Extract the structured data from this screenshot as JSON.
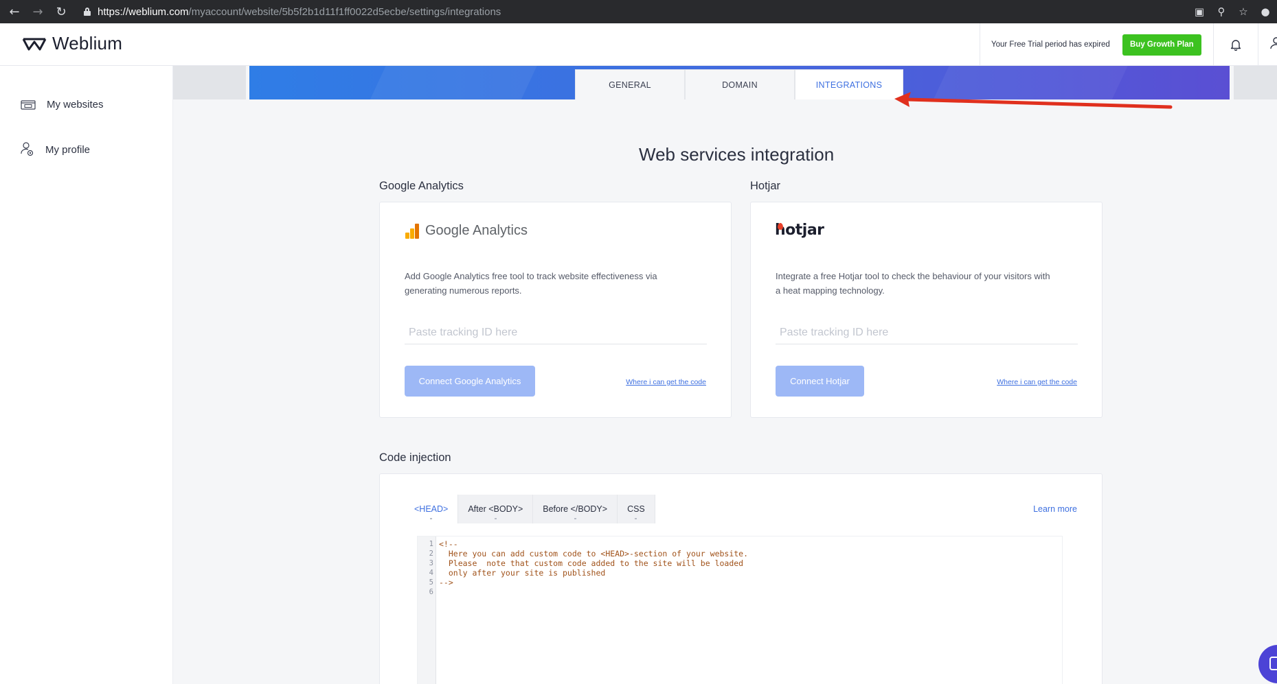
{
  "browser": {
    "url_main": "https://weblium.com",
    "url_rest": "/myaccount/website/5b5f2b1d11f1ff0022d5ecbe/settings/integrations"
  },
  "header": {
    "logo_text": "Weblium",
    "trial_text": "Your Free Trial period has expired",
    "buy_button": "Buy Growth Plan"
  },
  "sidebar": {
    "items": [
      {
        "label": "My websites",
        "icon": "websites-icon"
      },
      {
        "label": "My profile",
        "icon": "profile-settings-icon"
      }
    ]
  },
  "tabs": [
    {
      "label": "GENERAL",
      "active": false
    },
    {
      "label": "DOMAIN",
      "active": false
    },
    {
      "label": "INTEGRATIONS",
      "active": true
    }
  ],
  "main": {
    "title": "Web services integration",
    "google": {
      "section_label": "Google Analytics",
      "logo_text": "Google Analytics",
      "description": "Add Google Analytics free tool to track website effectiveness via generating numerous reports.",
      "placeholder": "Paste tracking ID here",
      "value": "",
      "button": "Connect Google Analytics",
      "link": "Where i can get the code"
    },
    "hotjar": {
      "section_label": "Hotjar",
      "logo_text": "hotjar",
      "description": "Integrate a free Hotjar tool to check the behaviour of your visitors with a heat mapping technology.",
      "placeholder": "Paste tracking ID here",
      "value": "",
      "button": "Connect Hotjar",
      "link": "Where i can get the code"
    },
    "code_injection": {
      "section_label": "Code injection",
      "tabs": [
        "<HEAD>",
        "After <BODY>",
        "Before </BODY>",
        "CSS"
      ],
      "active_tab": "<HEAD>",
      "learn_more": "Learn more",
      "line_numbers": [
        "1",
        "2",
        "3",
        "4",
        "5",
        "6"
      ],
      "code_lines": [
        "<!--",
        "  Here you can add custom code to <HEAD>-section of your website.",
        "  Please  note that custom code added to the site will be loaded",
        "  only after your site is published",
        "-->",
        ""
      ]
    }
  },
  "colors": {
    "accent": "#3d6fe0",
    "buy_green": "#3cc220",
    "connect_disabled": "#9db8f6",
    "annotation_arrow": "#e0301e",
    "code_comment": "#a0521a"
  }
}
